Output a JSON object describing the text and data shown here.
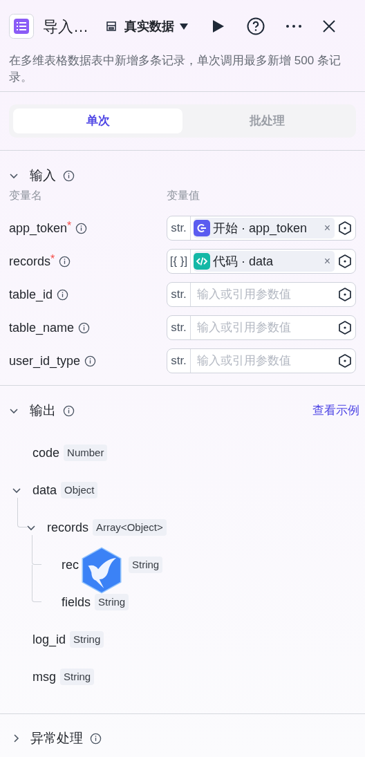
{
  "header": {
    "title": "导入…",
    "data_mode": "真实数据",
    "description": "在多维表格数据表中新增多条记录，单次调用最多新增 500 条记录。"
  },
  "tabs": [
    {
      "label": "单次",
      "selected": true
    },
    {
      "label": "批处理",
      "selected": false
    }
  ],
  "input": {
    "title": "输入",
    "expanded": true,
    "columns": [
      "变量名",
      "变量值"
    ],
    "rows": [
      {
        "name": "app_token",
        "required_mark": "*",
        "type": "str.",
        "kind": "start",
        "reference": "开始 · app_token",
        "remove": "×"
      },
      {
        "name": "records",
        "required_mark": "*",
        "type": "[{ }]",
        "kind": "code",
        "reference": "代码 · data",
        "remove": "×"
      },
      {
        "name": "table_id",
        "type": "str.",
        "kind": "empty",
        "placeholder": "输入或引用参数值"
      },
      {
        "name": "table_name",
        "type": "str.",
        "kind": "empty",
        "placeholder": "输入或引用参数值"
      },
      {
        "name": "user_id_type",
        "type": "str.",
        "kind": "empty",
        "placeholder": "输入或引用参数值"
      }
    ]
  },
  "output": {
    "title": "输出",
    "expanded": true,
    "link": "查看示例",
    "fields": [
      {
        "name": "code",
        "type": "Number"
      },
      {
        "name": "data",
        "type": "Object",
        "expanded": true,
        "children": [
          {
            "name": "records",
            "type": "Array<Object>",
            "expanded": true,
            "children": [
              {
                "name": "rec",
                "type": "String",
                "kind": "covered"
              },
              {
                "name": "fields",
                "type": "String"
              }
            ]
          }
        ]
      },
      {
        "name": "log_id",
        "type": "String"
      },
      {
        "name": "msg",
        "type": "String"
      }
    ]
  },
  "error_handling": {
    "title": "异常处理",
    "expanded": false
  }
}
